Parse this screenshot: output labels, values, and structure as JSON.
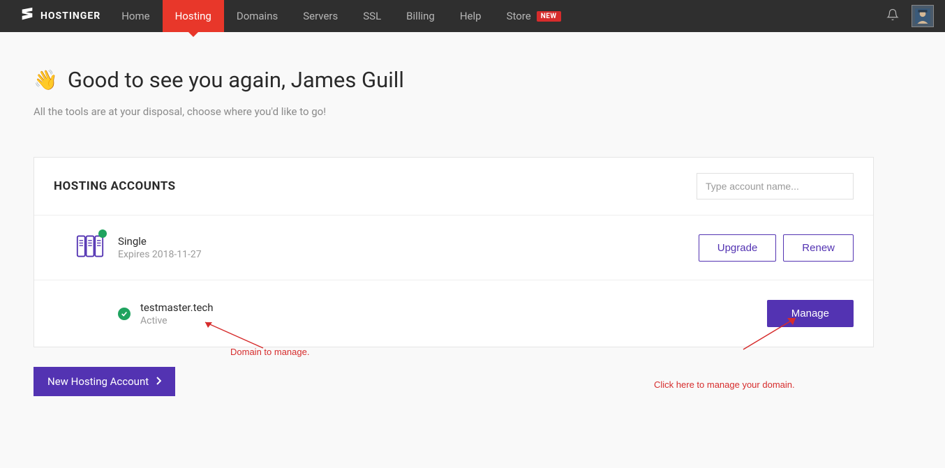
{
  "brand": "HOSTINGER",
  "nav": {
    "items": [
      "Home",
      "Hosting",
      "Domains",
      "Servers",
      "SSL",
      "Billing",
      "Help",
      "Store"
    ],
    "active_index": 1,
    "store_badge": "NEW"
  },
  "greeting": {
    "emoji": "👋",
    "text": "Good to see you again, James Guill",
    "subtitle": "All the tools are at your disposal, choose where you'd like to go!"
  },
  "panel": {
    "title": "HOSTING ACCOUNTS",
    "search_placeholder": "Type account name...",
    "account": {
      "plan": "Single",
      "expires": "Expires 2018-11-27",
      "upgrade_label": "Upgrade",
      "renew_label": "Renew"
    },
    "domain": {
      "name": "testmaster.tech",
      "status": "Active",
      "manage_label": "Manage"
    }
  },
  "new_account_label": "New Hosting Account",
  "annotations": {
    "domain": "Domain to manage.",
    "manage": "Click here to manage your domain."
  }
}
